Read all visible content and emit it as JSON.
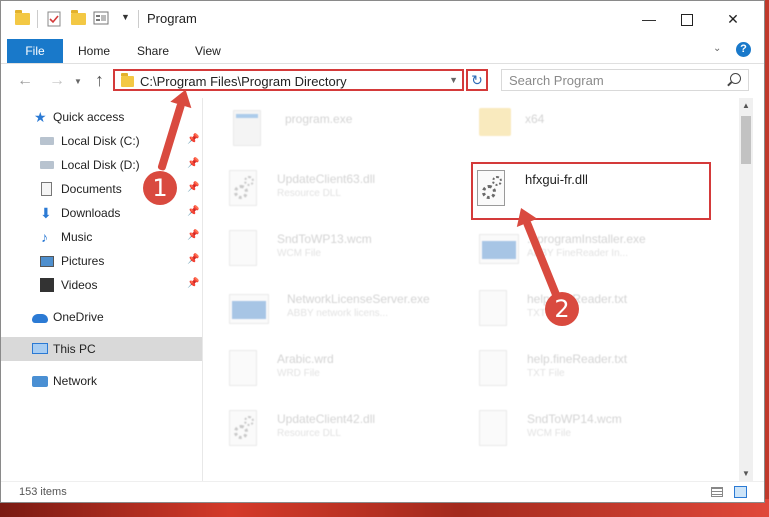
{
  "window": {
    "title": "Program",
    "minimize_glyph": "—",
    "close_glyph": "✕"
  },
  "ribbon": {
    "file_tab": "File",
    "tabs": [
      "Home",
      "Share",
      "View"
    ],
    "help_glyph": "?"
  },
  "nav": {
    "address": "C:\\Program Files\\Program Directory",
    "search_placeholder": "Search Program",
    "refresh_glyph": "↻"
  },
  "sidebar": {
    "items": [
      {
        "label": "Quick access",
        "icon": "star-icon"
      },
      {
        "label": "Local Disk (C:)",
        "icon": "drive-icon",
        "pinned": true
      },
      {
        "label": "Local Disk (D:)",
        "icon": "drive-icon",
        "pinned": true
      },
      {
        "label": "Documents",
        "icon": "documents-icon",
        "pinned": true
      },
      {
        "label": "Downloads",
        "icon": "downloads-icon",
        "pinned": true
      },
      {
        "label": "Music",
        "icon": "music-icon",
        "pinned": true
      },
      {
        "label": "Pictures",
        "icon": "pictures-icon",
        "pinned": true
      },
      {
        "label": "Videos",
        "icon": "videos-icon",
        "pinned": true
      },
      {
        "label": "OneDrive",
        "icon": "onedrive-icon"
      },
      {
        "label": "This PC",
        "icon": "this-pc-icon",
        "selected": true
      },
      {
        "label": "Network",
        "icon": "network-icon"
      }
    ]
  },
  "files": {
    "left": [
      {
        "name": "program.exe",
        "type": ""
      },
      {
        "name": "UpdateClient63.dll",
        "type": "Resource DLL"
      },
      {
        "name": "SndToWP13.wcm",
        "type": "WCM File"
      },
      {
        "name": "NetworkLicenseServer.exe",
        "type": "ABBY network licens..."
      },
      {
        "name": "Arabic.wrd",
        "type": "WRD File"
      },
      {
        "name": "UpdateClient42.dll",
        "type": "Resource DLL"
      }
    ],
    "right": [
      {
        "name": "x64",
        "type": ""
      },
      {
        "name": "hfxgui-fr.dll",
        "type": ""
      },
      {
        "name": "...programInstaller.exe",
        "type": "ABBY FineReader In..."
      },
      {
        "name": "help.fineReader.txt",
        "type": "TXT File"
      },
      {
        "name": "help.fineReader.txt",
        "type": "TXT File"
      },
      {
        "name": "SndToWP14.wcm",
        "type": "WCM File"
      }
    ]
  },
  "status": {
    "item_count": "153 items"
  },
  "annotations": {
    "step1": "1",
    "step2": "2"
  },
  "colors": {
    "accent": "#1979ca",
    "highlight": "#d43a3a",
    "annotation": "#d94a3f"
  }
}
